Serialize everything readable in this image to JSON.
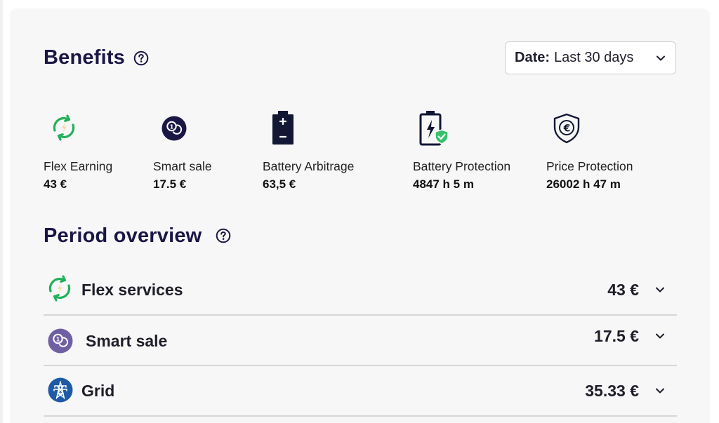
{
  "benefits": {
    "title": "Benefits",
    "help_icon": "question-circle-icon",
    "date_filter": {
      "label": "Date:",
      "value": "Last 30 days",
      "icon": "chevron-down-icon"
    },
    "items": [
      {
        "label": "Flex Earning",
        "value": "43 €",
        "icon": "flex-recycle-icon"
      },
      {
        "label": "Smart sale",
        "value": "17.5 €",
        "icon": "coins-icon"
      },
      {
        "label": "Battery Arbitrage",
        "value": "63,5 €",
        "icon": "battery-plus-minus-icon"
      },
      {
        "label": "Battery Protection",
        "value": "4847 h 5 m",
        "icon": "battery-shield-icon"
      },
      {
        "label": "Price Protection",
        "value": "26002 h 47 m",
        "icon": "euro-shield-icon"
      }
    ]
  },
  "period_overview": {
    "title": "Period overview",
    "help_icon": "question-circle-icon",
    "rows": [
      {
        "label": "Flex services",
        "value": "43 €",
        "icon": "flex-recycle-icon"
      },
      {
        "label": "Smart sale",
        "value": "17.5 €",
        "icon": "coins-icon"
      },
      {
        "label": "Grid",
        "value": "35.33 €",
        "icon": "power-pylon-icon"
      }
    ]
  },
  "colors": {
    "title": "#1a1645",
    "flex_green": "#22b05a",
    "smart_sale_purple": "#6f5fa3",
    "grid_blue": "#1f5aa6",
    "battery_navy": "#121735",
    "shield_green": "#35c26a"
  }
}
